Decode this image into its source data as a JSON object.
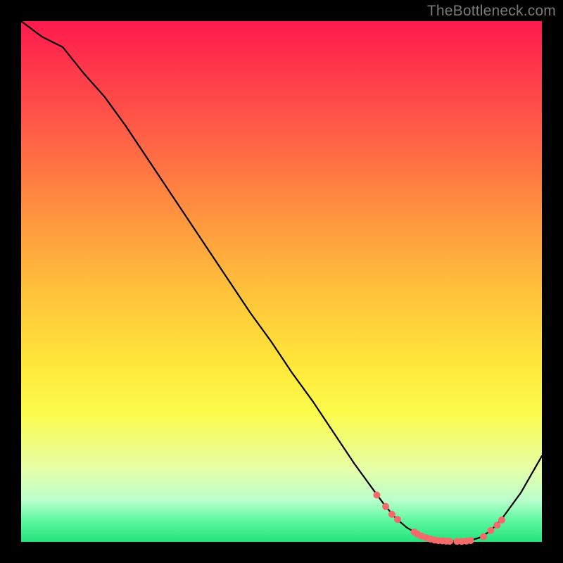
{
  "watermark": "TheBottleneck.com",
  "colors": {
    "background": "#000000",
    "curve": "#000000",
    "marker_fill": "#f46a6a",
    "marker_stroke": "#f46a6a",
    "gradient_top": "#ff1a4e",
    "gradient_bottom": "#24e37a"
  },
  "chart_data": {
    "type": "line",
    "title": "",
    "xlabel": "",
    "ylabel": "",
    "xlim": [
      0,
      100
    ],
    "ylim": [
      0,
      100
    ],
    "series": [
      {
        "name": "bottleneck-curve",
        "x": [
          0,
          4,
          8,
          12,
          16,
          20,
          24,
          28,
          32,
          36,
          40,
          44,
          48,
          52,
          56,
          60,
          64,
          68,
          70,
          72,
          74,
          76,
          78,
          80,
          82,
          84,
          86,
          88,
          90,
          92,
          96,
          100
        ],
        "y": [
          100,
          97,
          95,
          90,
          85.5,
          80,
          74,
          68,
          62,
          56,
          50,
          44,
          38.5,
          32.5,
          27,
          21,
          15,
          9.5,
          6.8,
          4.5,
          2.8,
          1.6,
          0.8,
          0.3,
          0.15,
          0.1,
          0.2,
          0.8,
          2.0,
          4.0,
          9.5,
          16.5
        ]
      }
    ],
    "markers": {
      "name": "highlighted-points",
      "x": [
        68.3,
        70.0,
        71.2,
        72.3,
        75.5,
        76.1,
        76.9,
        77.8,
        78.6,
        79.4,
        80.1,
        80.9,
        81.6,
        82.3,
        83.7,
        84.6,
        85.5,
        86.3,
        88.8,
        90.2,
        91.4,
        92.3
      ],
      "y": [
        9.0,
        6.8,
        5.3,
        4.3,
        1.9,
        1.5,
        1.1,
        0.8,
        0.55,
        0.35,
        0.25,
        0.2,
        0.15,
        0.12,
        0.1,
        0.1,
        0.15,
        0.25,
        1.0,
        2.2,
        3.2,
        4.2
      ]
    }
  }
}
